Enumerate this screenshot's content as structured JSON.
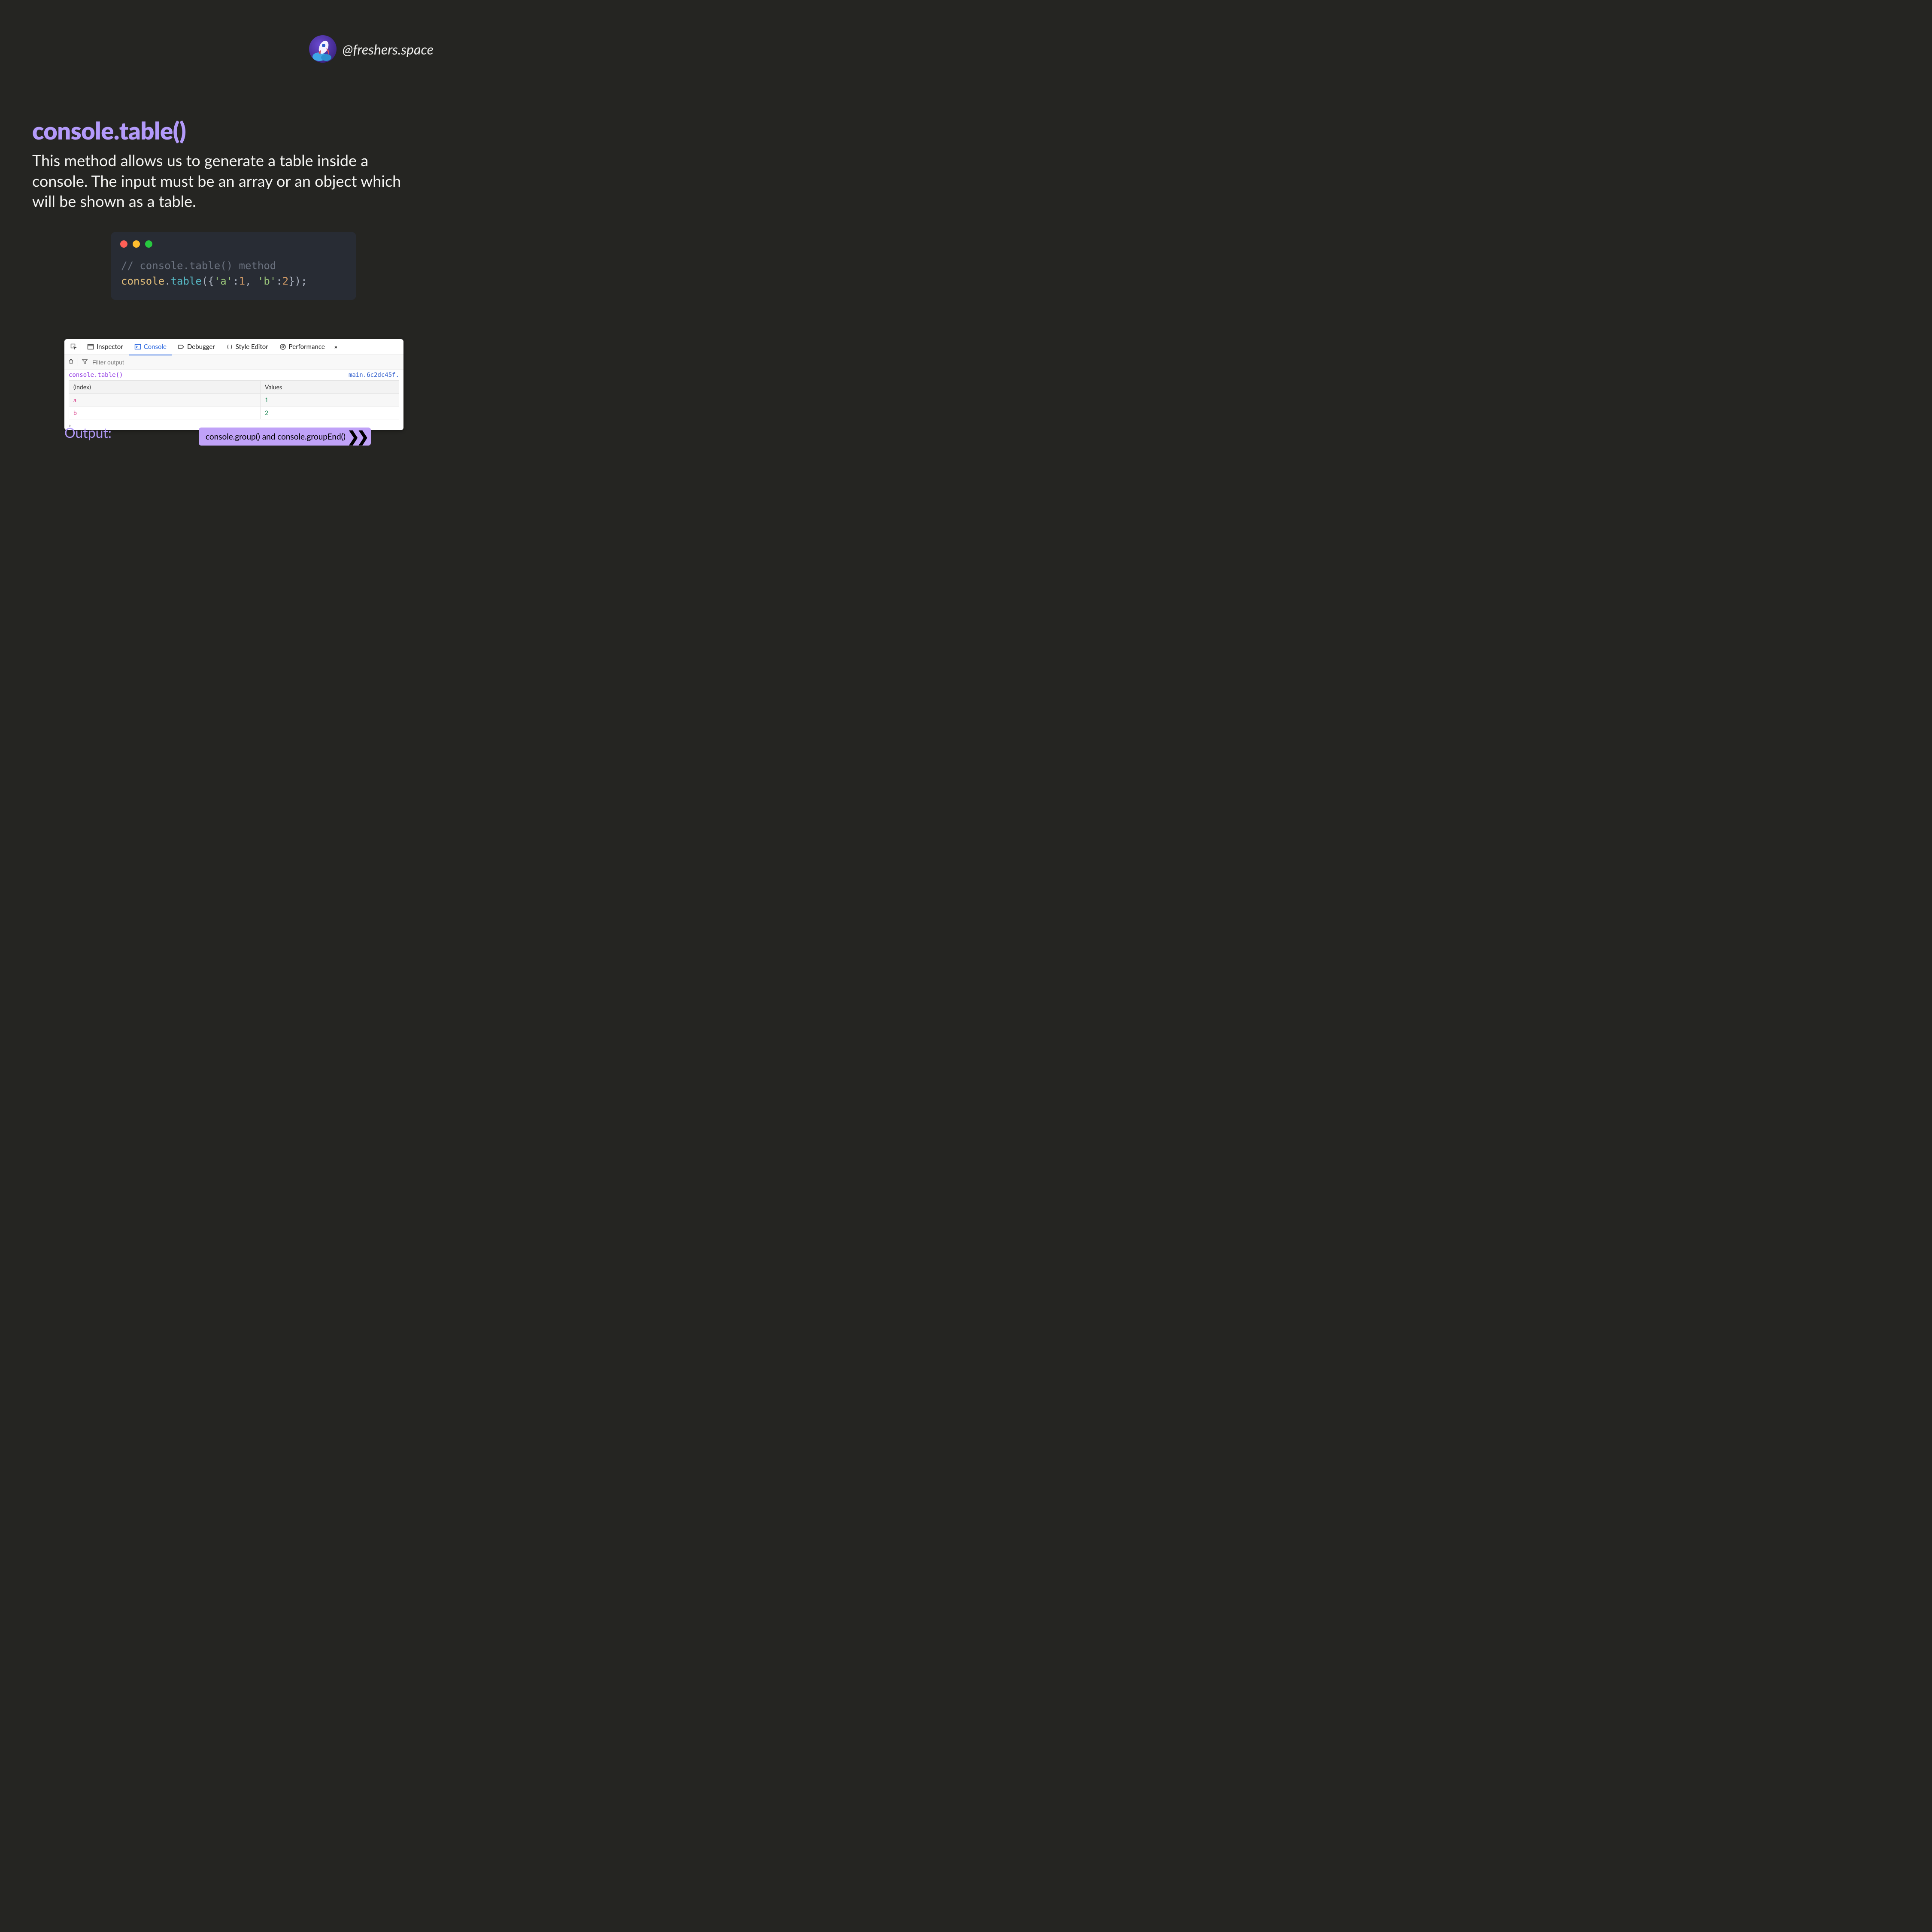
{
  "brand": {
    "handle": "@freshers.space"
  },
  "title": "console.table()",
  "description": "This method allows us to generate a table inside a console. The input must be an array or an object which will be shown as a table.",
  "code": {
    "comment": "// console.table() method",
    "obj": "console",
    "func": "table",
    "key_a": "'a'",
    "val_a": "1",
    "key_b": "'b'",
    "val_b": "2"
  },
  "devtools": {
    "tabs": {
      "inspector": "Inspector",
      "console": "Console",
      "debugger": "Debugger",
      "style_editor": "Style Editor",
      "performance": "Performance",
      "overflow": "»"
    },
    "filter_placeholder": "Filter output",
    "log_call": "console.table()",
    "log_source": "main.6c2dc45f.",
    "headers": {
      "index": "(index)",
      "values": "Values"
    },
    "rows": [
      {
        "index": "a",
        "value": "1"
      },
      {
        "index": "b",
        "value": "2"
      }
    ],
    "prompt": "»"
  },
  "output_label": "Output:",
  "next_label": "console.group() and console.groupEnd()"
}
